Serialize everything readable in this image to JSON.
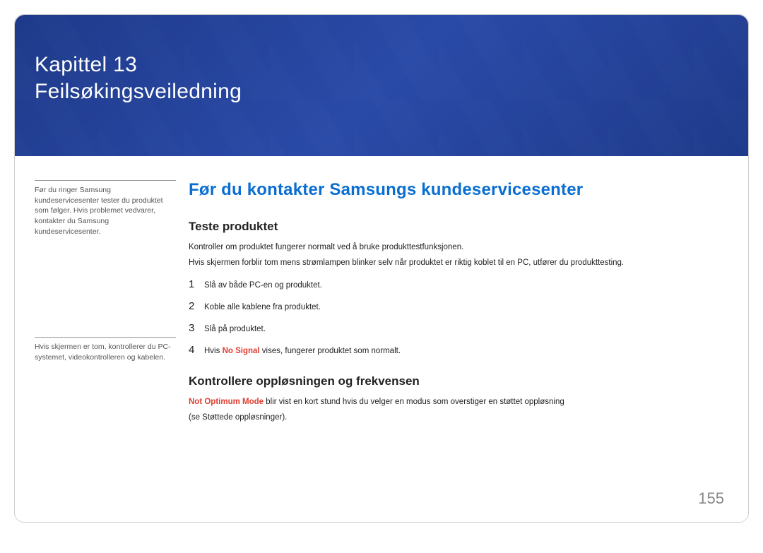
{
  "header": {
    "chapter_line": "Kapittel 13",
    "chapter_title": "Feilsøkingsveiledning"
  },
  "sidebar": {
    "note1": "Før du ringer Samsung kundeservicesenter tester du produktet som følger. Hvis problemet vedvarer, kontakter du Samsung kundeservicesenter.",
    "note2": "Hvis skjermen er tom, kontrollerer du PC-systemet, videokontrolleren og kabelen."
  },
  "main": {
    "heading": "Før du kontakter Samsungs kundeservicesenter",
    "section1": {
      "title": "Teste produktet",
      "p1": "Kontroller om produktet fungerer normalt ved å bruke produkttestfunksjonen.",
      "p2": "Hvis skjermen forblir tom mens strømlampen blinker selv når produktet er riktig koblet til en PC, utfører du produkttesting.",
      "steps": [
        {
          "num": "1",
          "text": "Slå av både PC-en og produktet."
        },
        {
          "num": "2",
          "text": "Koble alle kablene fra produktet."
        },
        {
          "num": "3",
          "text": "Slå på produktet."
        },
        {
          "num": "4",
          "prefix": "Hvis ",
          "highlight": "No Signal",
          "suffix": " vises, fungerer produktet som normalt."
        }
      ]
    },
    "section2": {
      "title": "Kontrollere oppløsningen og frekvensen",
      "p1_highlight": "Not Optimum Mode",
      "p1_suffix": " blir vist en kort stund hvis du velger en modus som overstiger en støttet oppløsning",
      "p2": "(se Støttede oppløsninger)."
    }
  },
  "page_number": "155"
}
